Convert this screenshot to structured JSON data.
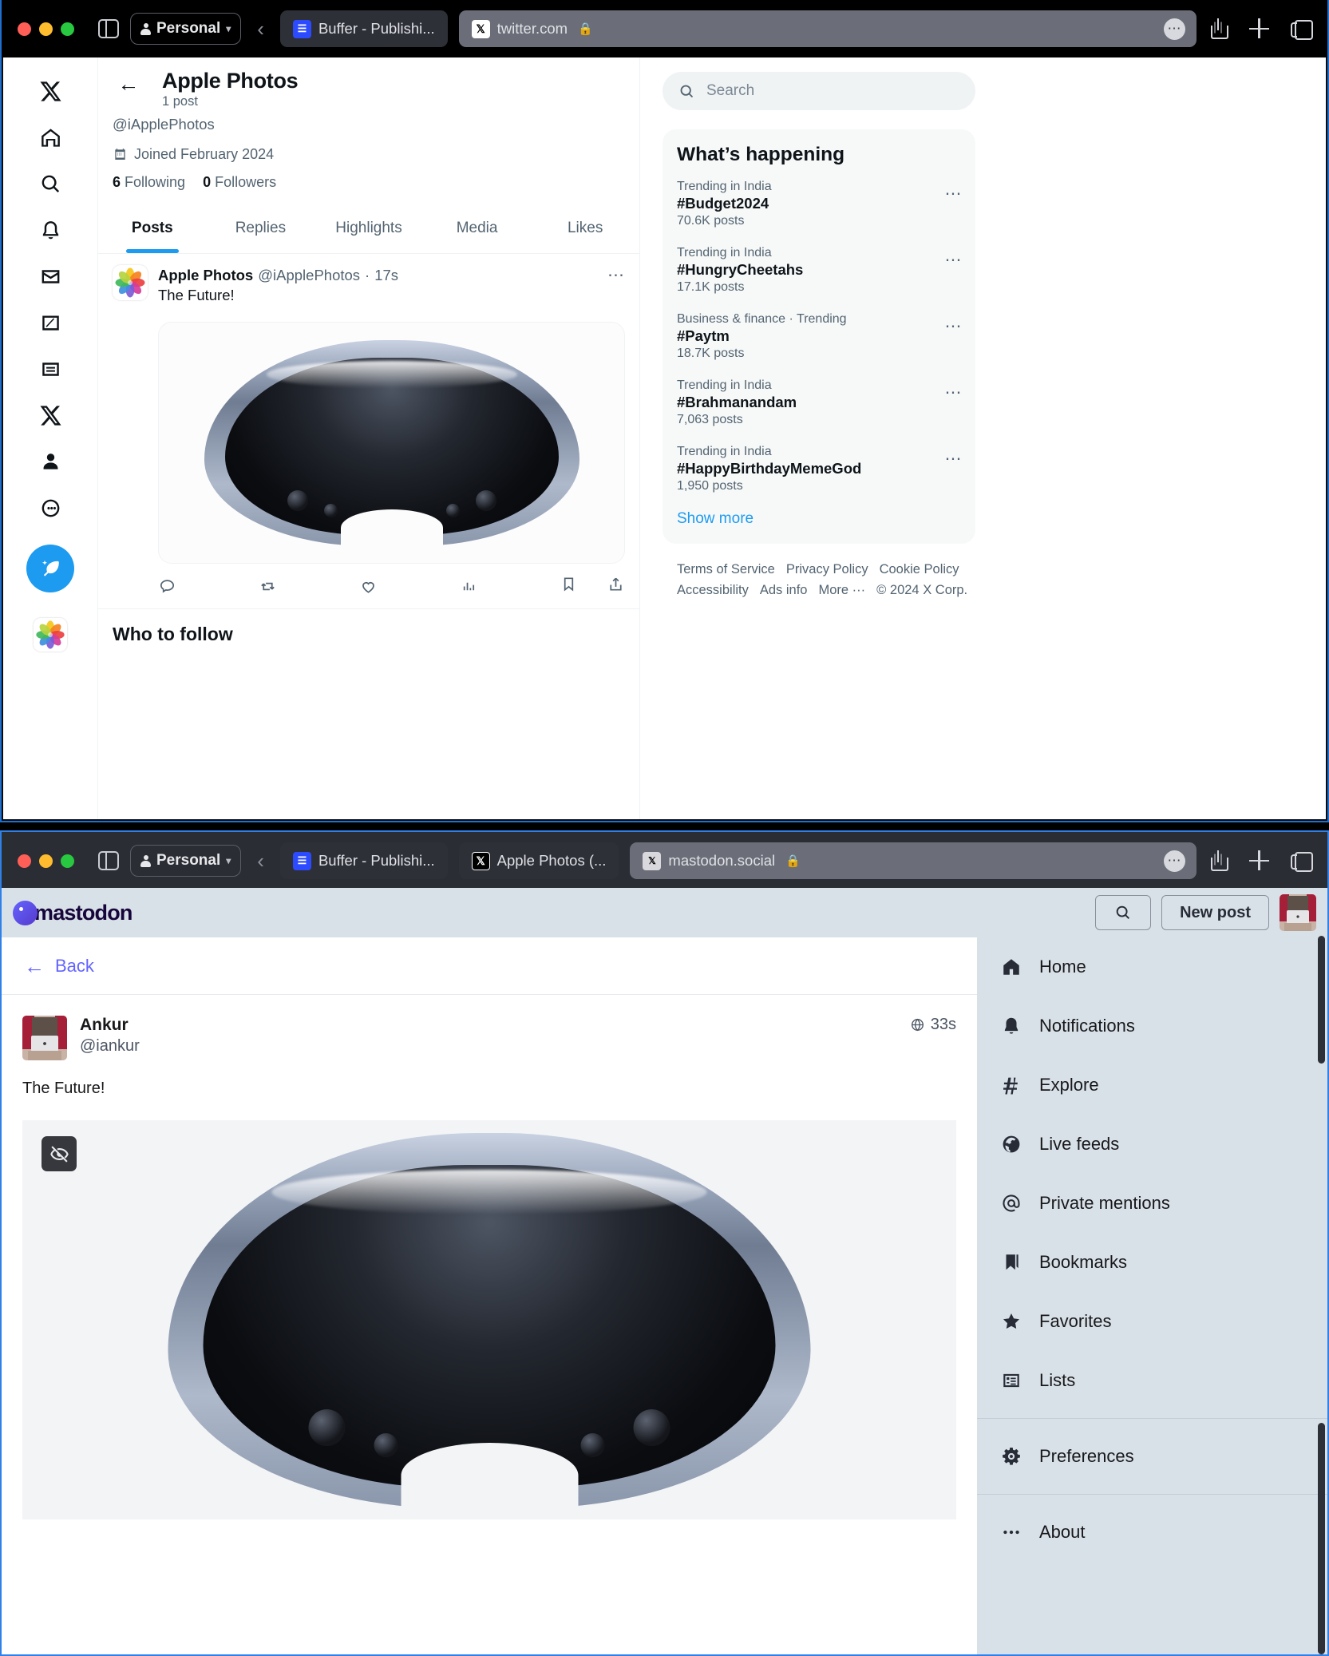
{
  "browser": {
    "profile_label": "Personal",
    "window_top": {
      "tabs": [
        {
          "title": "Buffer - Publishi...",
          "favicon": "buffer-icon",
          "active": false
        },
        {
          "title": "twitter.com",
          "favicon": "x-icon",
          "active": true,
          "secure": true
        }
      ]
    },
    "window_bottom": {
      "tabs": [
        {
          "title": "Buffer - Publishi...",
          "favicon": "buffer-icon",
          "active": false
        },
        {
          "title": "Apple Photos (...",
          "favicon": "x-icon",
          "active": false
        },
        {
          "title": "mastodon.social",
          "favicon": "mastodon-icon",
          "active": true,
          "secure": true
        }
      ]
    }
  },
  "twitter": {
    "sidebar_icons": [
      "x-logo-icon",
      "home-icon",
      "search-icon",
      "notifications-bell-icon",
      "messages-envelope-icon",
      "grok-icon",
      "lists-icon",
      "premium-x-icon",
      "profile-person-icon",
      "more-circle-icon"
    ],
    "compose_icon": "compose-post-icon",
    "account_avatar": "apple-photos-avatar",
    "profile": {
      "back_icon": "back-arrow-icon",
      "name": "Apple Photos",
      "post_count": "1 post",
      "handle": "@iApplePhotos",
      "joined_icon": "calendar-icon",
      "joined": "Joined February 2024",
      "following_count": "6",
      "following_label": "Following",
      "followers_count": "0",
      "followers_label": "Followers"
    },
    "tabs": [
      {
        "label": "Posts",
        "selected": true
      },
      {
        "label": "Replies",
        "selected": false
      },
      {
        "label": "Highlights",
        "selected": false
      },
      {
        "label": "Media",
        "selected": false
      },
      {
        "label": "Likes",
        "selected": false
      }
    ],
    "post": {
      "author": "Apple Photos",
      "handle": "@iApplePhotos",
      "separator": "·",
      "timestamp": "17s",
      "more_icon": "more-dots-icon",
      "text": "The Future!",
      "image_alt": "apple-vision-pro-headset",
      "actions": [
        "reply-icon",
        "repost-icon",
        "like-icon",
        "views-icon",
        "bookmark-icon",
        "share-icon"
      ]
    },
    "who_to_follow": "Who to follow",
    "search": {
      "placeholder": "Search",
      "icon": "search-icon"
    },
    "whats_happening": {
      "title": "What’s happening",
      "trends": [
        {
          "category": "Trending in India",
          "tag": "#Budget2024",
          "count": "70.6K posts"
        },
        {
          "category": "Trending in India",
          "tag": "#HungryCheetahs",
          "count": "17.1K posts"
        },
        {
          "category": "Business & finance · Trending",
          "tag": "#Paytm",
          "count": "18.7K posts"
        },
        {
          "category": "Trending in India",
          "tag": "#Brahmanandam",
          "count": "7,063 posts"
        },
        {
          "category": "Trending in India",
          "tag": "#HappyBirthdayMemeGod",
          "count": "1,950 posts"
        }
      ],
      "show_more": "Show more"
    },
    "footer": [
      "Terms of Service",
      "Privacy Policy",
      "Cookie Policy",
      "Accessibility",
      "Ads info",
      "More ···",
      "© 2024 X Corp."
    ]
  },
  "mastodon": {
    "brand": "mastodon",
    "header": {
      "search_icon": "search-icon",
      "new_post_label": "New post",
      "avatar": "user-avatar"
    },
    "back_label": "Back",
    "post": {
      "display_name": "Ankur",
      "account": "@iankur",
      "visibility_icon": "globe-icon",
      "timestamp": "33s",
      "text": "The Future!",
      "media_alt": "apple-vision-pro-headset",
      "hide_media_icon": "eye-off-icon"
    },
    "nav": [
      {
        "label": "Home",
        "icon": "home-icon"
      },
      {
        "label": "Notifications",
        "icon": "bell-icon"
      },
      {
        "label": "Explore",
        "icon": "hash-icon"
      },
      {
        "label": "Live feeds",
        "icon": "globe-icon"
      },
      {
        "label": "Private mentions",
        "icon": "at-icon"
      },
      {
        "label": "Bookmarks",
        "icon": "bookmark-icon"
      },
      {
        "label": "Favorites",
        "icon": "star-icon"
      },
      {
        "label": "Lists",
        "icon": "list-icon"
      }
    ],
    "nav_secondary": [
      {
        "label": "Preferences",
        "icon": "gear-icon"
      }
    ],
    "nav_tertiary": [
      {
        "label": "About",
        "icon": "ellipsis-icon"
      }
    ]
  },
  "colors": {
    "twitter_blue": "#1d9bf0",
    "mastodon_purple": "#6364ff",
    "mastodon_bg": "#d9e1e8",
    "chrome_dark": "#000000"
  }
}
